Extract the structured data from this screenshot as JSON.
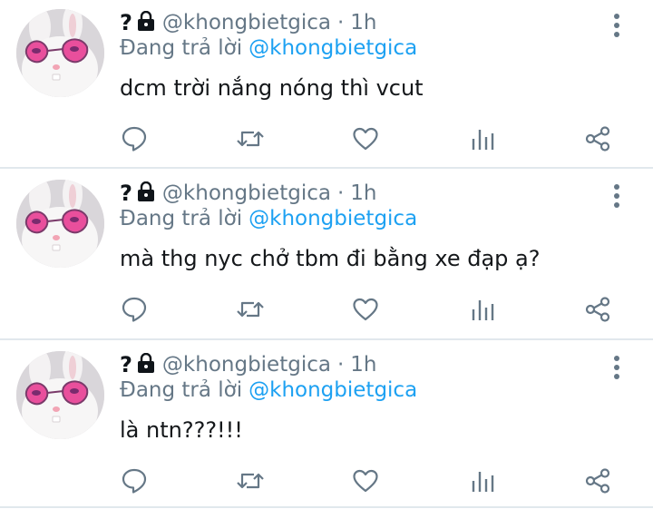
{
  "tweets": [
    {
      "name_char": "?",
      "handle": "@khongbietgica",
      "separator": "·",
      "time": "1h",
      "replying_prefix": "Đang trả lời",
      "replying_to": "@khongbietgica",
      "text": "dcm trời nắng nóng thì vcut"
    },
    {
      "name_char": "?",
      "handle": "@khongbietgica",
      "separator": "·",
      "time": "1h",
      "replying_prefix": "Đang trả lời",
      "replying_to": "@khongbietgica",
      "text": "mà thg nyc chở tbm đi bằng xe đạp ạ?"
    },
    {
      "name_char": "?",
      "handle": "@khongbietgica",
      "separator": "·",
      "time": "1h",
      "replying_prefix": "Đang trả lời",
      "replying_to": "@khongbietgica",
      "text": "là ntn???!!!"
    }
  ],
  "icons": [
    "lock-icon",
    "more-vertical-icon",
    "reply-icon",
    "retweet-icon",
    "like-icon",
    "stats-icon",
    "share-icon"
  ],
  "colors": {
    "text": "#0f1419",
    "secondary": "#657786",
    "link": "#1da1f2",
    "icon": "#657786",
    "divider": "#e1e8ed"
  }
}
